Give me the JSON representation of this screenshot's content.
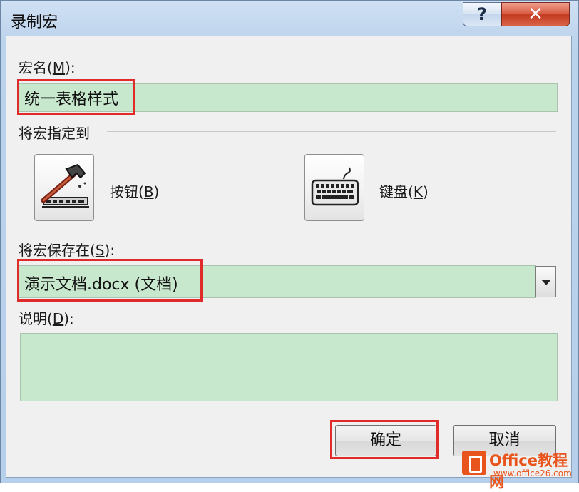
{
  "window": {
    "title": "录制宏"
  },
  "titlebar": {
    "help_glyph": "?",
    "close_glyph": "✕"
  },
  "macro_name": {
    "label_pre": "宏名(",
    "label_key": "M",
    "label_post": "):",
    "value": "统一表格样式"
  },
  "assign": {
    "label": "将宏指定到",
    "button": {
      "label_pre": "按钮(",
      "label_key": "B",
      "label_post": ")",
      "icon": "hammer-toolbar-icon"
    },
    "keyboard": {
      "label_pre": "键盘(",
      "label_key": "K",
      "label_post": ")",
      "icon": "keyboard-icon"
    }
  },
  "store_in": {
    "label_pre": "将宏保存在(",
    "label_key": "S",
    "label_post": "):",
    "value": "演示文档.docx (文档)"
  },
  "description": {
    "label_pre": "说明(",
    "label_key": "D",
    "label_post": "):",
    "value": ""
  },
  "footer": {
    "ok_label": "确定",
    "cancel_label": "取消"
  },
  "watermark": {
    "brand": "Office教程网",
    "url": "www.office26.com"
  },
  "colors": {
    "field_bg": "#c8e8cd",
    "highlight": "#e02b2b"
  }
}
